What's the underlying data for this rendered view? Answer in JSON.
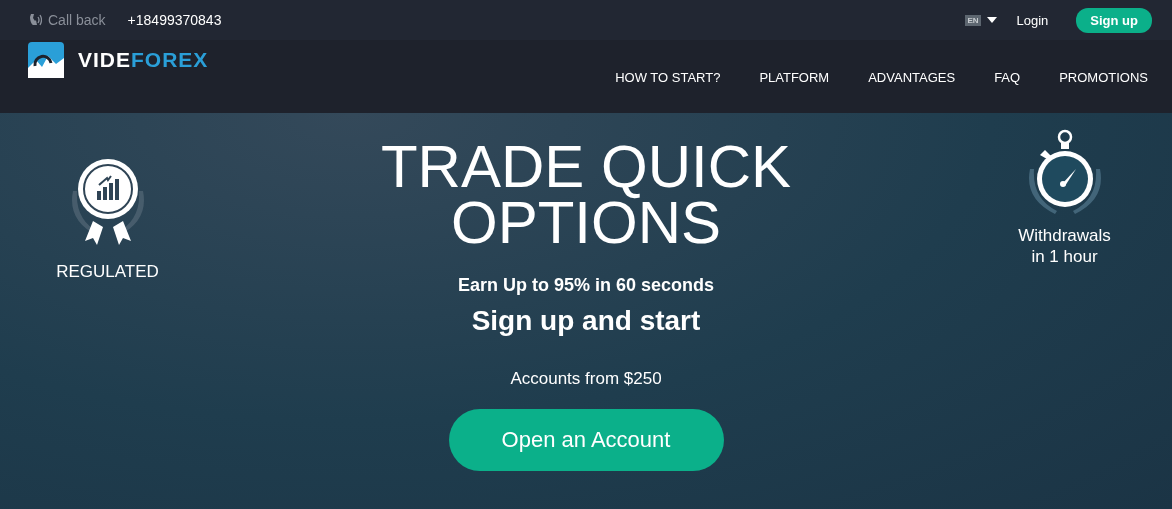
{
  "top_bar": {
    "callback": "Call back",
    "phone": "+18499370843",
    "language": "EN",
    "login": "Login",
    "signup": "Sign up"
  },
  "logo": {
    "parts": [
      {
        "text": "VIDE",
        "color": "#ffffff"
      },
      {
        "text": "FOREX",
        "color": "#2a9fd8"
      }
    ]
  },
  "nav": [
    {
      "label": "HOW TO START?"
    },
    {
      "label": "PLATFORM"
    },
    {
      "label": "ADVANTAGES"
    },
    {
      "label": "FAQ"
    },
    {
      "label": "PROMOTIONS"
    }
  ],
  "hero": {
    "title": "TRADE QUICK OPTIONS",
    "subtitle": "Earn Up to 95% in 60 seconds",
    "cta_heading": "Sign up and start",
    "accounts": "Accounts from $250",
    "button": "Open an Account",
    "badges": [
      {
        "kind": "ribbon",
        "label": "REGULATED"
      },
      {
        "kind": "stopwatch",
        "label": "Withdrawals in 1 hour"
      }
    ]
  }
}
